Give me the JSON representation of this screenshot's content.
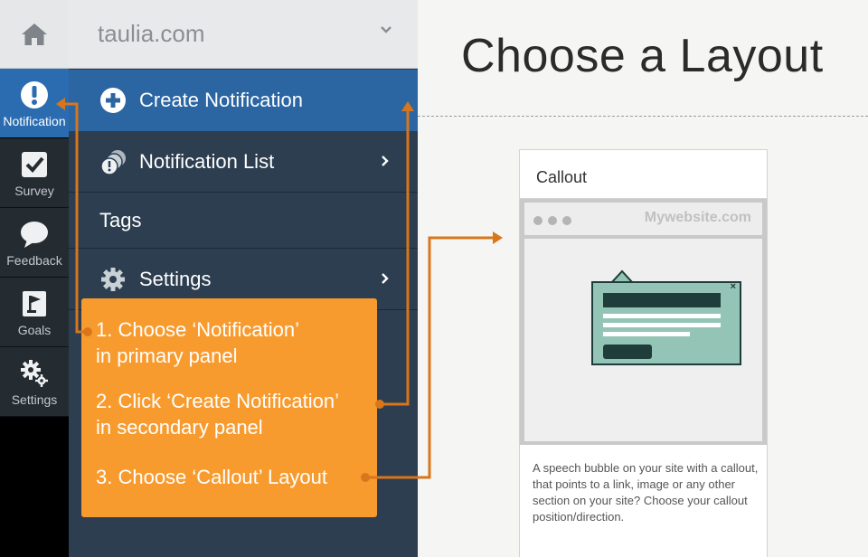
{
  "rail": {
    "home_icon": "home-icon",
    "items": [
      {
        "label": "Notification",
        "icon": "exclamation-circle-icon",
        "active": true
      },
      {
        "label": "Survey",
        "icon": "checkbox-icon",
        "active": false
      },
      {
        "label": "Feedback",
        "icon": "speech-bubble-icon",
        "active": false
      },
      {
        "label": "Goals",
        "icon": "flag-icon",
        "active": false
      },
      {
        "label": "Settings",
        "icon": "gears-icon",
        "active": false
      }
    ]
  },
  "secondary": {
    "domain": "taulia.com",
    "menu": [
      {
        "label": "Create Notification",
        "icon": "plus-circle-icon",
        "active": true,
        "has_arrow": false
      },
      {
        "label": "Notification List",
        "icon": "stacked-circles-icon",
        "active": false,
        "has_arrow": true
      },
      {
        "label": "Tags",
        "icon": "",
        "active": false,
        "has_arrow": false
      },
      {
        "label": "Settings",
        "icon": "gear-icon",
        "active": false,
        "has_arrow": true
      }
    ]
  },
  "content": {
    "title": "Choose a Layout",
    "card": {
      "title": "Callout",
      "site_label": "Mywebsite.com",
      "description": "A speech bubble on your site with a callout, that points to a link, image or any other section on your site? Choose your callout position/direction."
    }
  },
  "instructions": {
    "step1": {
      "line1": "1. Choose ‘Notification’",
      "line2": "in primary panel"
    },
    "step2": {
      "line1": "2. Click ‘Create Notification’",
      "line2": "in secondary panel"
    },
    "step3": {
      "line1": "3. Choose ‘Callout’ Layout"
    }
  },
  "colors": {
    "accent_blue": "#2b66a3",
    "panel_dark": "#2c3e50",
    "instruction_orange": "#f89b2e",
    "arrow_orange": "#d9761c",
    "callout_green": "#93c4b5",
    "callout_dark": "#1f3d3a"
  }
}
